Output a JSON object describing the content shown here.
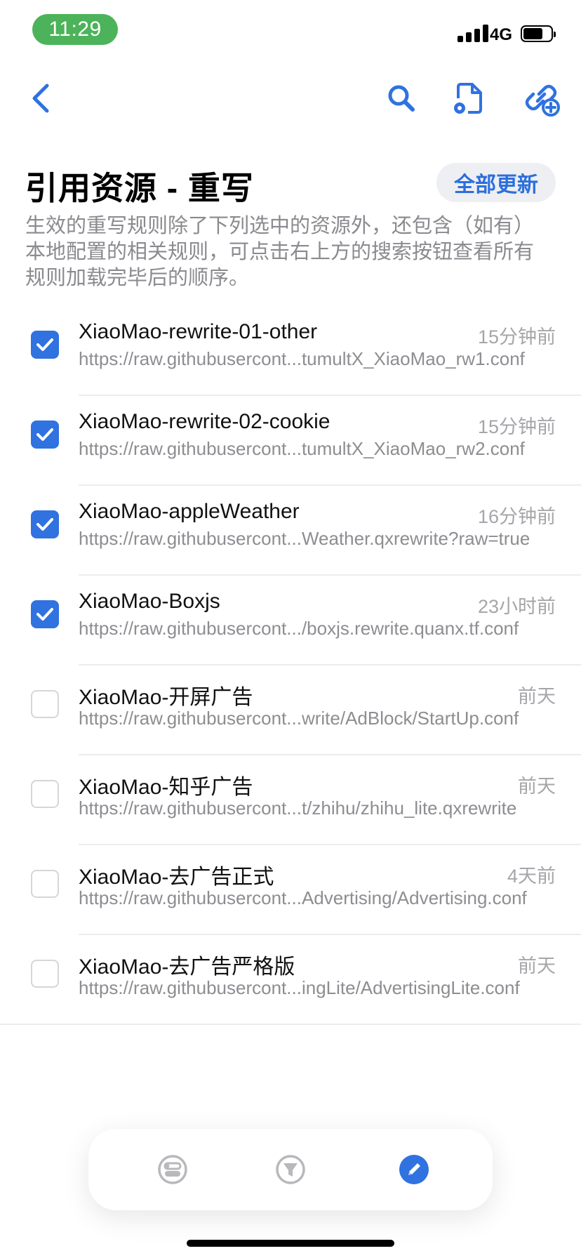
{
  "status_bar": {
    "time": "11:29",
    "network": "4G"
  },
  "nav": {
    "back_icon": "chevron-left-icon",
    "search_icon": "search-icon",
    "file_settings_icon": "file-gear-icon",
    "add_link_icon": "link-plus-icon"
  },
  "header": {
    "title": "引用资源 - 重写",
    "update_all_label": "全部更新",
    "description": "生效的重写规则除了下列选中的资源外，还包含（如有）本地配置的相关规则，可点击右上方的搜索按钮查看所有规则加载完毕后的顺序。"
  },
  "colors": {
    "accent": "#2f72e0",
    "time_pill": "#4cb35a"
  },
  "resources": [
    {
      "name": "XiaoMao-rewrite-01-other",
      "url": "https://raw.githubusercont...tumultX_XiaoMao_rw1.conf",
      "updated": "15分钟前",
      "checked": true
    },
    {
      "name": "XiaoMao-rewrite-02-cookie",
      "url": "https://raw.githubusercont...tumultX_XiaoMao_rw2.conf",
      "updated": "15分钟前",
      "checked": true
    },
    {
      "name": "XiaoMao-appleWeather",
      "url": "https://raw.githubusercont...Weather.qxrewrite?raw=true",
      "updated": "16分钟前",
      "checked": true
    },
    {
      "name": "XiaoMao-Boxjs",
      "url": "https://raw.githubusercont.../boxjs.rewrite.quanx.tf.conf",
      "updated": "23小时前",
      "checked": true
    },
    {
      "name": "XiaoMao-开屏广告",
      "url": "https://raw.githubusercont...write/AdBlock/StartUp.conf",
      "updated": "前天",
      "checked": false
    },
    {
      "name": "XiaoMao-知乎广告",
      "url": "https://raw.githubusercont...t/zhihu/zhihu_lite.qxrewrite",
      "updated": "前天",
      "checked": false
    },
    {
      "name": "XiaoMao-去广告正式",
      "url": "https://raw.githubusercont...Advertising/Advertising.conf",
      "updated": "4天前",
      "checked": false
    },
    {
      "name": "XiaoMao-去广告严格版",
      "url": "https://raw.githubusercont...ingLite/AdvertisingLite.conf",
      "updated": "前天",
      "checked": false
    }
  ],
  "tabbar": {
    "tabs": [
      {
        "icon": "toggles-icon",
        "active": false
      },
      {
        "icon": "filter-icon",
        "active": false
      },
      {
        "icon": "pencil-icon",
        "active": true
      }
    ]
  }
}
